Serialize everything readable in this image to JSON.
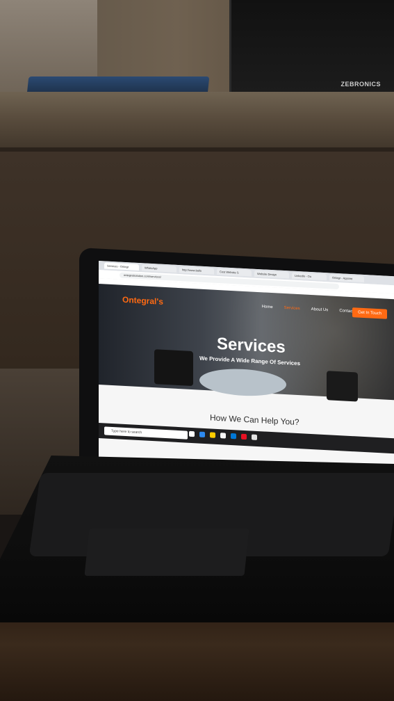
{
  "monitor": {
    "brand": "ZEBRONICS"
  },
  "browser": {
    "tabs": [
      "Services - Ontegr",
      "WhatsApp",
      "http://www.ballo",
      "Cost Website S",
      "Website Design",
      "LinkedIn - Ou",
      "Ontegr - Appoint"
    ],
    "url": "ontegralsolution.com/services/"
  },
  "site": {
    "logo": "Ontegral's",
    "nav": {
      "home": "Home",
      "services": "Services",
      "about": "About Us",
      "contact": "Contact"
    },
    "cta": "Get In Touch",
    "hero_title": "Services",
    "hero_subtitle": "We Provide A Wide Range Of Services",
    "section_title": "How We Can Help You?"
  },
  "taskbar": {
    "search_placeholder": "Type here to search"
  }
}
